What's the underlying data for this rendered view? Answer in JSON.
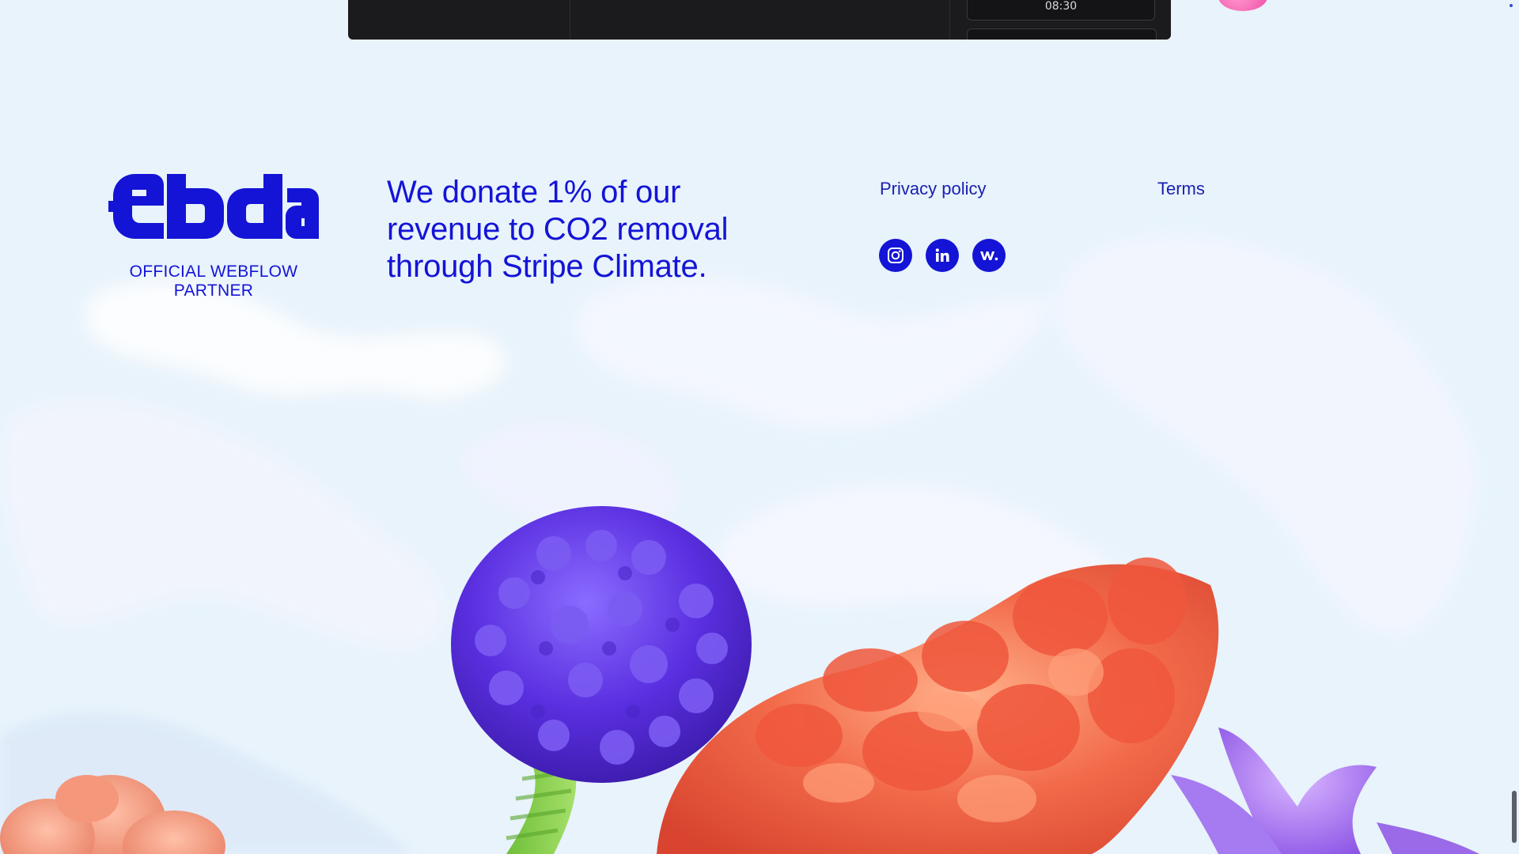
{
  "video_panel": {
    "time": "08:30"
  },
  "brand": {
    "logo_text": "ebda",
    "partner": "OFFICIAL WEBFLOW PARTNER"
  },
  "footer": {
    "donation_statement": "We donate 1% of our revenue to CO2 removal through Stripe Climate.",
    "links": {
      "privacy": "Privacy policy",
      "terms": "Terms"
    },
    "socials": [
      {
        "name": "Instagram",
        "icon": "instagram-icon"
      },
      {
        "name": "LinkedIn",
        "icon": "linkedin-icon",
        "glyph": "in"
      },
      {
        "name": "Webflow",
        "icon": "webflow-icon",
        "glyph": "w."
      }
    ]
  },
  "colors": {
    "brand_blue": "#1414d6",
    "background": "#e8f3fb",
    "panel": "#1b1b1d"
  }
}
